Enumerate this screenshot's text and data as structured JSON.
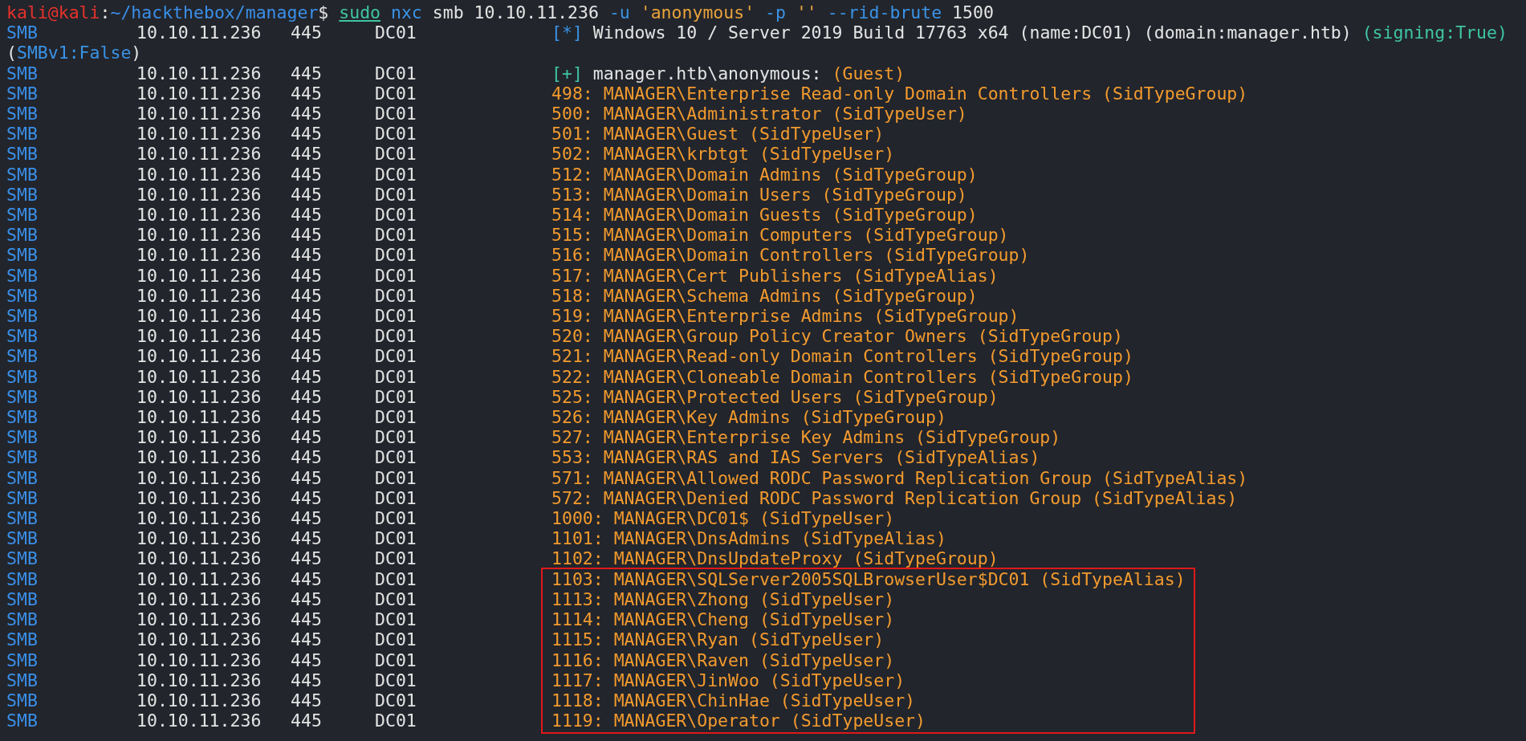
{
  "prompt": {
    "user_host": "kali@kali",
    "separator": ":",
    "path": "~/hackthebox/manager",
    "symbol": "$",
    "command": [
      {
        "text": "sudo",
        "kind": "sudo"
      },
      {
        "text": "nxc",
        "kind": "cmd"
      },
      {
        "text": "smb",
        "kind": "arg"
      },
      {
        "text": "10.10.11.236",
        "kind": "arg"
      },
      {
        "text": "-u",
        "kind": "flag"
      },
      {
        "text": "'anonymous'",
        "kind": "string"
      },
      {
        "text": "-p",
        "kind": "flag"
      },
      {
        "text": "''",
        "kind": "string"
      },
      {
        "text": "--rid-brute",
        "kind": "flag"
      },
      {
        "text": "1500",
        "kind": "arg"
      }
    ]
  },
  "rows": [
    {
      "protocol": "SMB",
      "host": "10.10.11.236",
      "port": "445",
      "name": "DC01",
      "message": [
        {
          "text": "[*]",
          "kind": "info"
        },
        {
          "text": "Windows 10 / Server 2019 Build 17763 x64 (name:DC01) (domain:manager.htb)",
          "kind": "plain"
        },
        {
          "text": "(signing:True)",
          "kind": "good"
        }
      ],
      "continuation": [
        {
          "text": "(",
          "kind": "plain"
        },
        {
          "text": "SMBv1:False",
          "kind": "info"
        },
        {
          "text": ")",
          "kind": "plain"
        }
      ]
    },
    {
      "protocol": "SMB",
      "host": "10.10.11.236",
      "port": "445",
      "name": "DC01",
      "message": [
        {
          "text": "[+]",
          "kind": "good"
        },
        {
          "text": "manager.htb\\anonymous:",
          "kind": "plain"
        },
        {
          "text": "(Guest)",
          "kind": "rid"
        }
      ]
    },
    {
      "protocol": "SMB",
      "host": "10.10.11.236",
      "port": "445",
      "name": "DC01",
      "message": [
        {
          "text": "498: MANAGER\\Enterprise Read-only Domain Controllers (SidTypeGroup)",
          "kind": "rid"
        }
      ]
    },
    {
      "protocol": "SMB",
      "host": "10.10.11.236",
      "port": "445",
      "name": "DC01",
      "message": [
        {
          "text": "500: MANAGER\\Administrator (SidTypeUser)",
          "kind": "rid"
        }
      ]
    },
    {
      "protocol": "SMB",
      "host": "10.10.11.236",
      "port": "445",
      "name": "DC01",
      "message": [
        {
          "text": "501: MANAGER\\Guest (SidTypeUser)",
          "kind": "rid"
        }
      ]
    },
    {
      "protocol": "SMB",
      "host": "10.10.11.236",
      "port": "445",
      "name": "DC01",
      "message": [
        {
          "text": "502: MANAGER\\krbtgt (SidTypeUser)",
          "kind": "rid"
        }
      ]
    },
    {
      "protocol": "SMB",
      "host": "10.10.11.236",
      "port": "445",
      "name": "DC01",
      "message": [
        {
          "text": "512: MANAGER\\Domain Admins (SidTypeGroup)",
          "kind": "rid"
        }
      ]
    },
    {
      "protocol": "SMB",
      "host": "10.10.11.236",
      "port": "445",
      "name": "DC01",
      "message": [
        {
          "text": "513: MANAGER\\Domain Users (SidTypeGroup)",
          "kind": "rid"
        }
      ]
    },
    {
      "protocol": "SMB",
      "host": "10.10.11.236",
      "port": "445",
      "name": "DC01",
      "message": [
        {
          "text": "514: MANAGER\\Domain Guests (SidTypeGroup)",
          "kind": "rid"
        }
      ]
    },
    {
      "protocol": "SMB",
      "host": "10.10.11.236",
      "port": "445",
      "name": "DC01",
      "message": [
        {
          "text": "515: MANAGER\\Domain Computers (SidTypeGroup)",
          "kind": "rid"
        }
      ]
    },
    {
      "protocol": "SMB",
      "host": "10.10.11.236",
      "port": "445",
      "name": "DC01",
      "message": [
        {
          "text": "516: MANAGER\\Domain Controllers (SidTypeGroup)",
          "kind": "rid"
        }
      ]
    },
    {
      "protocol": "SMB",
      "host": "10.10.11.236",
      "port": "445",
      "name": "DC01",
      "message": [
        {
          "text": "517: MANAGER\\Cert Publishers (SidTypeAlias)",
          "kind": "rid"
        }
      ]
    },
    {
      "protocol": "SMB",
      "host": "10.10.11.236",
      "port": "445",
      "name": "DC01",
      "message": [
        {
          "text": "518: MANAGER\\Schema Admins (SidTypeGroup)",
          "kind": "rid"
        }
      ]
    },
    {
      "protocol": "SMB",
      "host": "10.10.11.236",
      "port": "445",
      "name": "DC01",
      "message": [
        {
          "text": "519: MANAGER\\Enterprise Admins (SidTypeGroup)",
          "kind": "rid"
        }
      ]
    },
    {
      "protocol": "SMB",
      "host": "10.10.11.236",
      "port": "445",
      "name": "DC01",
      "message": [
        {
          "text": "520: MANAGER\\Group Policy Creator Owners (SidTypeGroup)",
          "kind": "rid"
        }
      ]
    },
    {
      "protocol": "SMB",
      "host": "10.10.11.236",
      "port": "445",
      "name": "DC01",
      "message": [
        {
          "text": "521: MANAGER\\Read-only Domain Controllers (SidTypeGroup)",
          "kind": "rid"
        }
      ]
    },
    {
      "protocol": "SMB",
      "host": "10.10.11.236",
      "port": "445",
      "name": "DC01",
      "message": [
        {
          "text": "522: MANAGER\\Cloneable Domain Controllers (SidTypeGroup)",
          "kind": "rid"
        }
      ]
    },
    {
      "protocol": "SMB",
      "host": "10.10.11.236",
      "port": "445",
      "name": "DC01",
      "message": [
        {
          "text": "525: MANAGER\\Protected Users (SidTypeGroup)",
          "kind": "rid"
        }
      ]
    },
    {
      "protocol": "SMB",
      "host": "10.10.11.236",
      "port": "445",
      "name": "DC01",
      "message": [
        {
          "text": "526: MANAGER\\Key Admins (SidTypeGroup)",
          "kind": "rid"
        }
      ]
    },
    {
      "protocol": "SMB",
      "host": "10.10.11.236",
      "port": "445",
      "name": "DC01",
      "message": [
        {
          "text": "527: MANAGER\\Enterprise Key Admins (SidTypeGroup)",
          "kind": "rid"
        }
      ]
    },
    {
      "protocol": "SMB",
      "host": "10.10.11.236",
      "port": "445",
      "name": "DC01",
      "message": [
        {
          "text": "553: MANAGER\\RAS and IAS Servers (SidTypeAlias)",
          "kind": "rid"
        }
      ]
    },
    {
      "protocol": "SMB",
      "host": "10.10.11.236",
      "port": "445",
      "name": "DC01",
      "message": [
        {
          "text": "571: MANAGER\\Allowed RODC Password Replication Group (SidTypeAlias)",
          "kind": "rid"
        }
      ]
    },
    {
      "protocol": "SMB",
      "host": "10.10.11.236",
      "port": "445",
      "name": "DC01",
      "message": [
        {
          "text": "572: MANAGER\\Denied RODC Password Replication Group (SidTypeAlias)",
          "kind": "rid"
        }
      ]
    },
    {
      "protocol": "SMB",
      "host": "10.10.11.236",
      "port": "445",
      "name": "DC01",
      "message": [
        {
          "text": "1000: MANAGER\\DC01$ (SidTypeUser)",
          "kind": "rid"
        }
      ]
    },
    {
      "protocol": "SMB",
      "host": "10.10.11.236",
      "port": "445",
      "name": "DC01",
      "message": [
        {
          "text": "1101: MANAGER\\DnsAdmins (SidTypeAlias)",
          "kind": "rid"
        }
      ]
    },
    {
      "protocol": "SMB",
      "host": "10.10.11.236",
      "port": "445",
      "name": "DC01",
      "message": [
        {
          "text": "1102: MANAGER\\DnsUpdateProxy (SidTypeGroup)",
          "kind": "rid"
        }
      ]
    }
  ],
  "highlighted_rows": [
    {
      "protocol": "SMB",
      "host": "10.10.11.236",
      "port": "445",
      "name": "DC01",
      "message": [
        {
          "text": "1103: MANAGER\\SQLServer2005SQLBrowserUser$DC01 (SidTypeAlias)",
          "kind": "rid"
        }
      ]
    },
    {
      "protocol": "SMB",
      "host": "10.10.11.236",
      "port": "445",
      "name": "DC01",
      "message": [
        {
          "text": "1113: MANAGER\\Zhong (SidTypeUser)",
          "kind": "rid"
        }
      ]
    },
    {
      "protocol": "SMB",
      "host": "10.10.11.236",
      "port": "445",
      "name": "DC01",
      "message": [
        {
          "text": "1114: MANAGER\\Cheng (SidTypeUser)",
          "kind": "rid"
        }
      ]
    },
    {
      "protocol": "SMB",
      "host": "10.10.11.236",
      "port": "445",
      "name": "DC01",
      "message": [
        {
          "text": "1115: MANAGER\\Ryan (SidTypeUser)",
          "kind": "rid"
        }
      ]
    },
    {
      "protocol": "SMB",
      "host": "10.10.11.236",
      "port": "445",
      "name": "DC01",
      "message": [
        {
          "text": "1116: MANAGER\\Raven (SidTypeUser)",
          "kind": "rid"
        }
      ]
    },
    {
      "protocol": "SMB",
      "host": "10.10.11.236",
      "port": "445",
      "name": "DC01",
      "message": [
        {
          "text": "1117: MANAGER\\JinWoo (SidTypeUser)",
          "kind": "rid"
        }
      ]
    },
    {
      "protocol": "SMB",
      "host": "10.10.11.236",
      "port": "445",
      "name": "DC01",
      "message": [
        {
          "text": "1118: MANAGER\\ChinHae (SidTypeUser)",
          "kind": "rid"
        }
      ]
    },
    {
      "protocol": "SMB",
      "host": "10.10.11.236",
      "port": "445",
      "name": "DC01",
      "message": [
        {
          "text": "1119: MANAGER\\Operator (SidTypeUser)",
          "kind": "rid"
        }
      ]
    }
  ]
}
